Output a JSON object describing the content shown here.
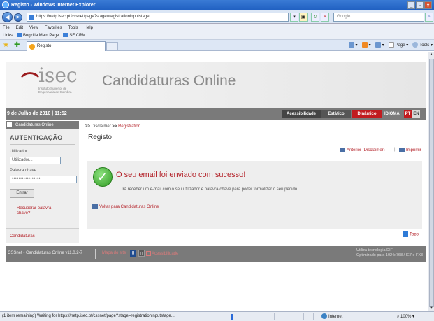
{
  "window": {
    "title": "Registo - Windows Internet Explorer"
  },
  "address": {
    "url": "https://netp.isec.pt/cssnet/page?stage=registrationinputstage",
    "search_placeholder": "Google"
  },
  "menu": [
    "File",
    "Edit",
    "View",
    "Favorites",
    "Tools",
    "Help"
  ],
  "links_bar": {
    "label": "Links",
    "items": [
      "Bugzilla Main Page",
      "SF CRM"
    ]
  },
  "tab": {
    "label": "Registo"
  },
  "command_bar": {
    "page": "Page",
    "tools": "Tools"
  },
  "site": {
    "logo_text": "isec",
    "logo_subtitle": "Instituto Superior de Engenharia de Coimbra",
    "title": "Candidaturas Online",
    "date": "9 de Julho de 2010 | 11:52",
    "buttons": {
      "acessibilidade": "Acessibilidade",
      "estatico": "Estático",
      "dinamico": "Dinâmico"
    },
    "idioma": "IDIOMA",
    "lang_pt": "PT",
    "lang_en": "EN"
  },
  "sidebar": {
    "home_label": "Candidaturas Online",
    "auth_title": "AUTENTICAÇÃO",
    "user_label": "Utilizador",
    "user_value": "Utilizador...",
    "pass_label": "Palavra chave",
    "pass_value": "•••••••••••••••••",
    "login_button": "Entrar",
    "recover_link": "Recuperar palavra chave?",
    "candidaturas_link": "Candidaturas"
  },
  "main": {
    "breadcrumb": [
      ">>",
      "Disclaimer",
      ">>",
      "Registration"
    ],
    "heading": "Registo",
    "prev_link": "Anterior (Disclaimer)",
    "separator": "|",
    "print_link": "Imprimir",
    "success_title": "O seu email foi enviado com sucesso!",
    "success_body": "Irá receber um e-mail com o seu utilizador e palavra-chave para poder formalizar o seu pedido.",
    "back_link": "Voltar para Candidaturas Online",
    "top_link": "Topo"
  },
  "footer": {
    "version": "CSSnet - Candidaturas Online v11.0.2-7",
    "sitemap": "Mapa do site",
    "acessibilidade": "Acessibilidade",
    "tech_line1": "Utiliza tecnologia DIF",
    "tech_line2": "Optimizado para 1024x768 / IE7 e FX3"
  },
  "status": {
    "text": "(1 item remaining) Waiting for https://netp.isec.pt/cssnet/page?stage=registrationinputstage...",
    "zone": "Internet",
    "zoom": "100%"
  }
}
